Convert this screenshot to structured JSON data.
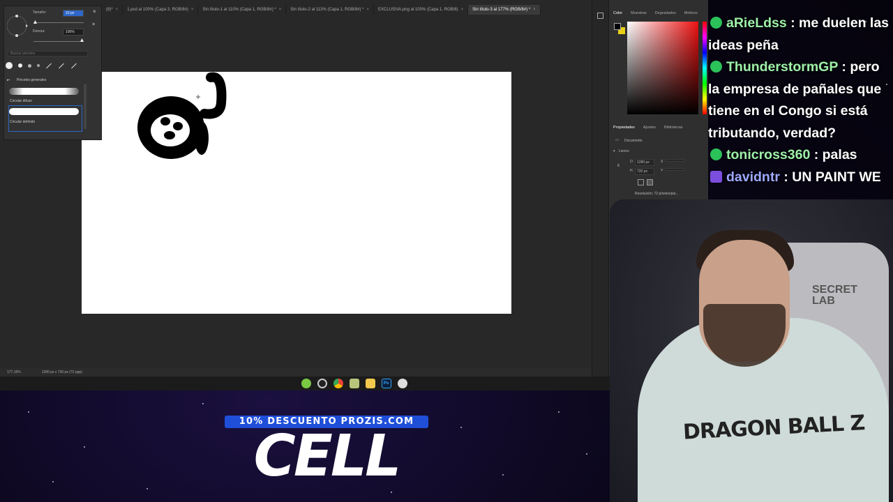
{
  "photoshop": {
    "tabs": [
      {
        "label": "(8)*",
        "active": false
      },
      {
        "label": "1.psd al 100% (Capa 3, RGB/8#)",
        "active": false
      },
      {
        "label": "Sin título-1 al 110% (Capa 1, RGB/8#) *",
        "active": false
      },
      {
        "label": "Sin título-2 al 113% (Capa 1, RGB/8#) *",
        "active": false
      },
      {
        "label": "EXCLUSIVA.png al 100% (Capa 1, RGB/8)",
        "active": false
      },
      {
        "label": "Sin título-3 al 177% (RGB/8#) *",
        "active": true
      }
    ],
    "status": {
      "zoom": "177,16%",
      "doc": "1280 px x 720 px (72 ppp)"
    },
    "brush_panel": {
      "size_label": "Tamaño:",
      "size_value": "10 px",
      "hardness_label": "Dureza:",
      "hardness_value": "100%",
      "search_placeholder": "Buscar pinceles",
      "group": "Pinceles generales",
      "brushes": [
        "Circular difuso",
        "Circular definido"
      ]
    },
    "panels": {
      "color_tabs": [
        "Color",
        "Muestras",
        "Degradados",
        "Motivos"
      ],
      "prop_tabs": [
        "Propiedades",
        "Ajustes",
        "Bibliotecas"
      ],
      "doc_label": "Documento",
      "canvas_label": "Lienzo",
      "w_label": "O",
      "w_value": "1280 px",
      "h_label": "H",
      "h_value": "720 px",
      "x_label": "X",
      "y_label": "Y",
      "resolution": "Resolución: 72 píxeles/pul..."
    }
  },
  "taskbar_icons": [
    "android-icon",
    "obs-icon",
    "chrome-icon",
    "app-icon",
    "folder-icon",
    "photoshop-icon",
    "browser-icon"
  ],
  "chat": [
    {
      "user": "aRieLdss",
      "text": ": me duelen las ideas peña",
      "badge": "green"
    },
    {
      "user": "ThunderstormGP",
      "text": ": pero la empresa de pañales que tiene en el Congo si está tributando, verdad?",
      "badge": "green"
    },
    {
      "user": "tonicross360",
      "text": ": palas",
      "badge": "green"
    },
    {
      "user": "davidntr",
      "text": ": UN PAINT WE",
      "badge": "purple"
    }
  ],
  "promo": {
    "banner": "10% DESCUENTO PROZIS.COM",
    "code": "CELL"
  },
  "webcam": {
    "hoodie_logo": "DRAGON BALL Z",
    "chair_text": "SECRET LAB"
  }
}
